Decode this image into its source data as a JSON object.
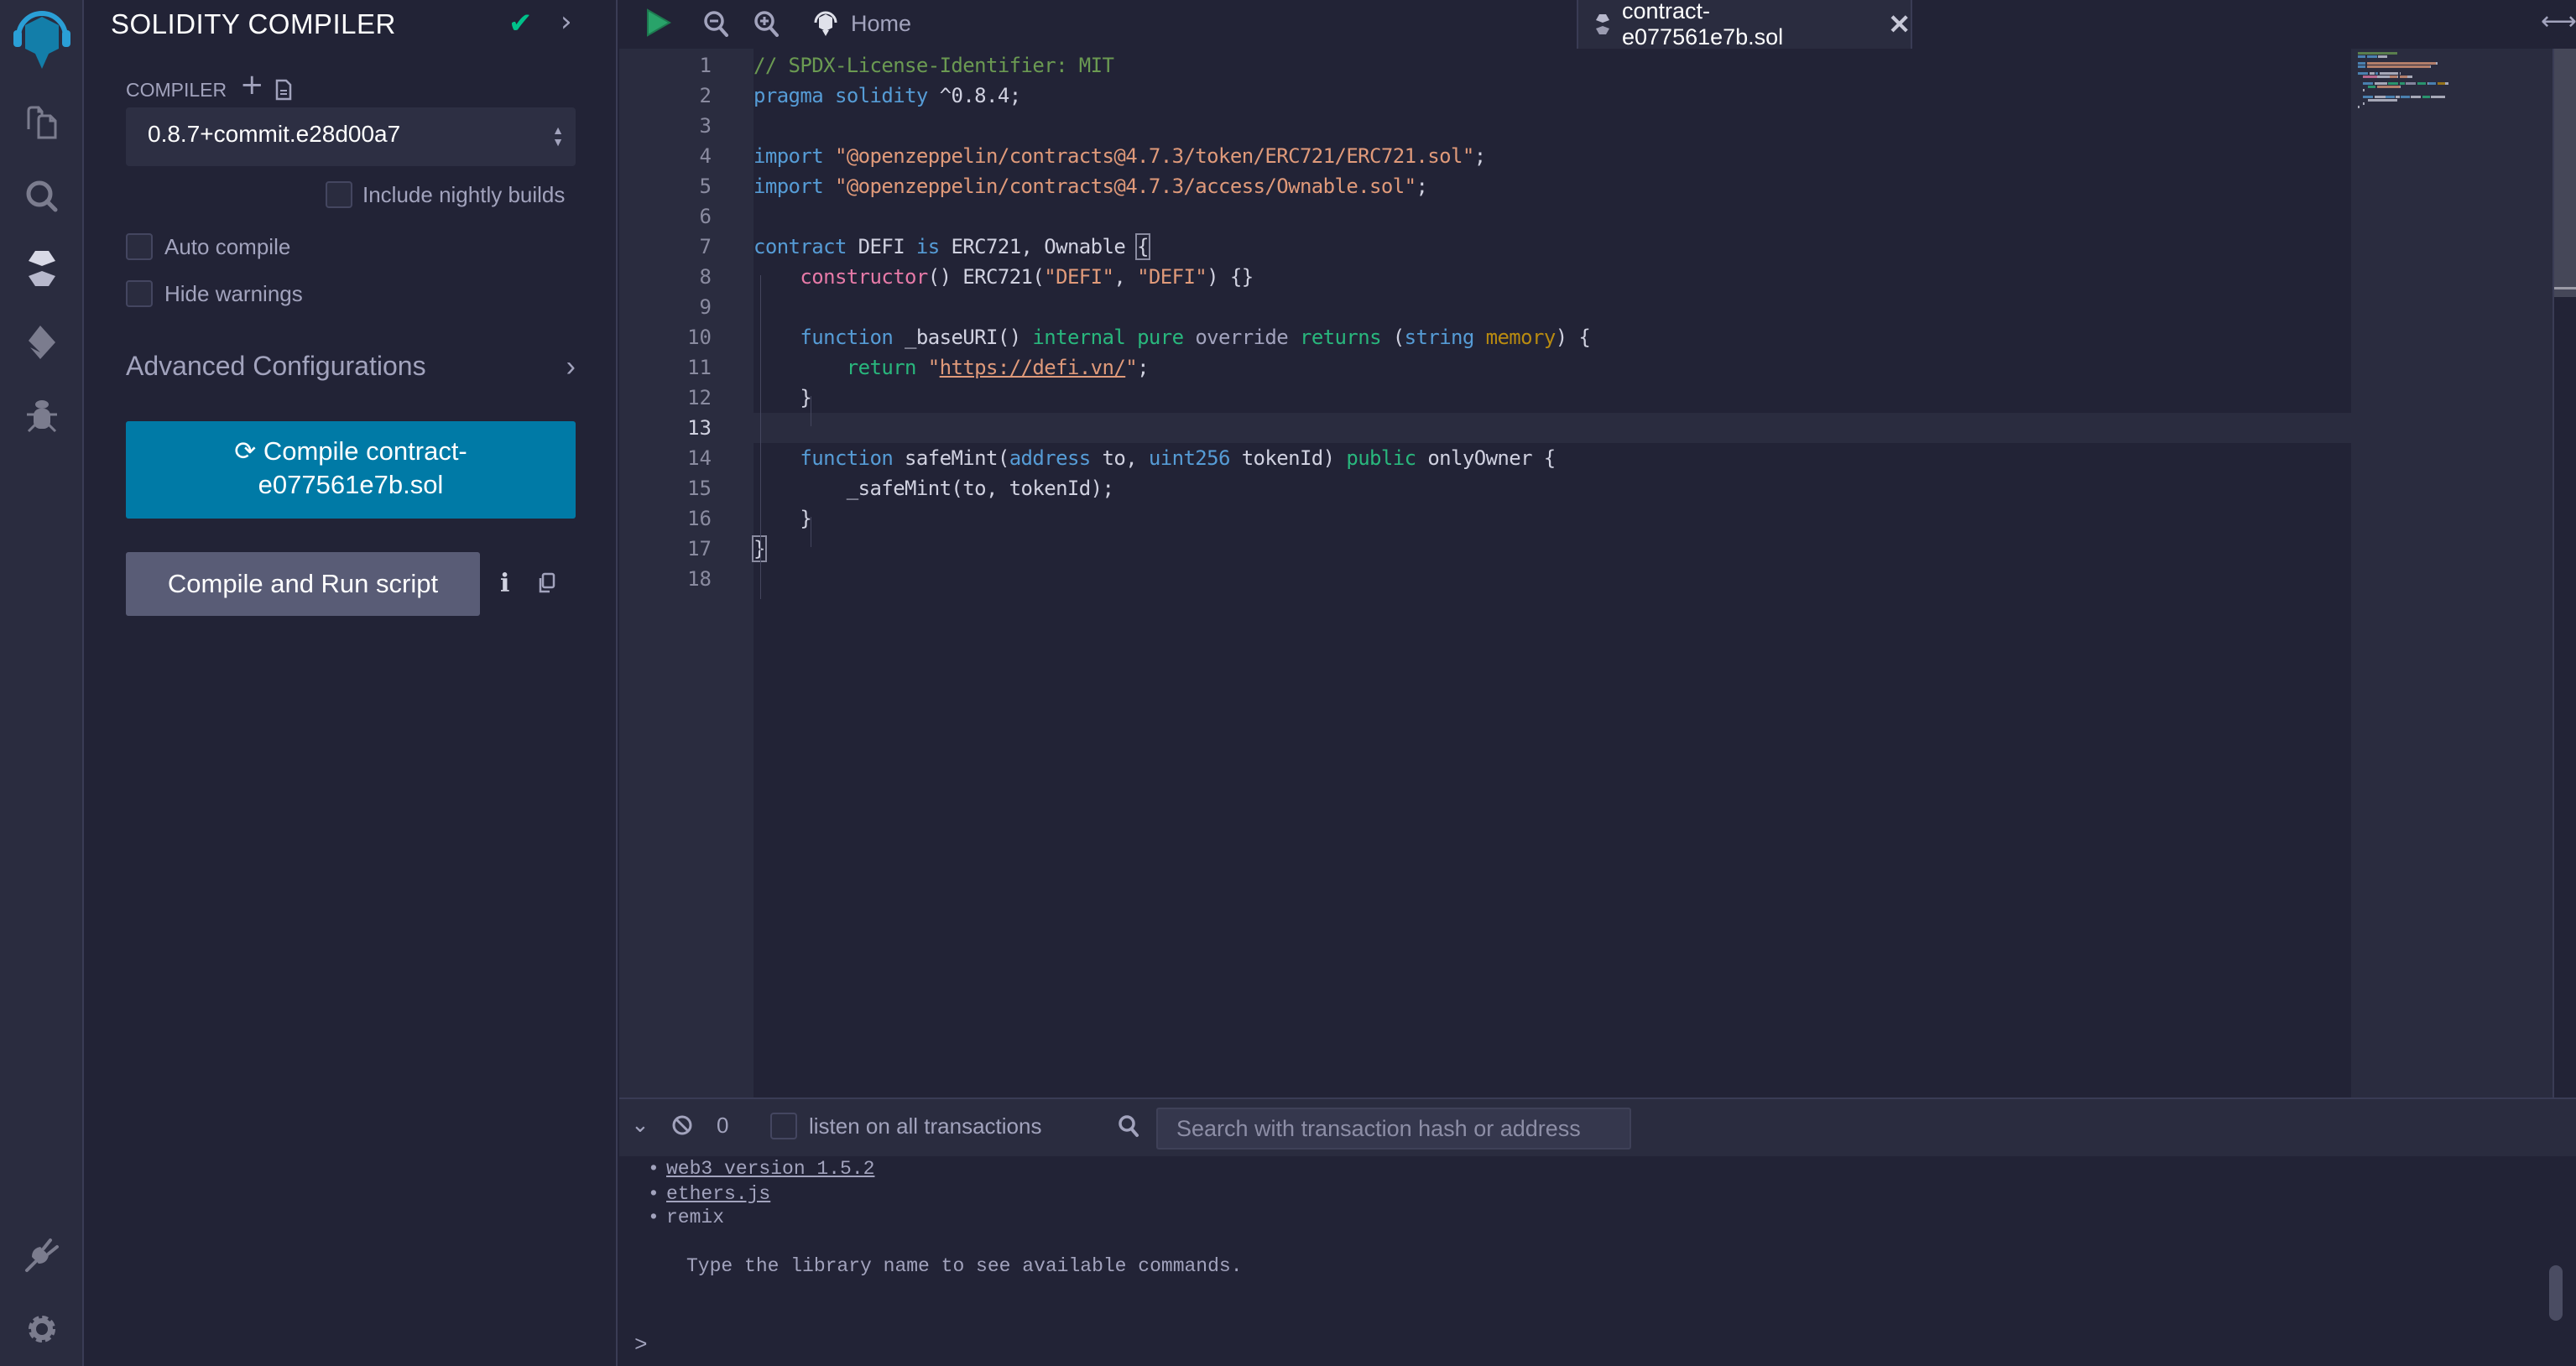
{
  "iconbar": {
    "items": [
      {
        "name": "home-logo",
        "label": "Remix home"
      },
      {
        "name": "file-explorer",
        "label": "File explorer"
      },
      {
        "name": "search",
        "label": "Search"
      },
      {
        "name": "solidity-compiler",
        "label": "Solidity compiler"
      },
      {
        "name": "deploy-run",
        "label": "Deploy & run transactions"
      },
      {
        "name": "debugger",
        "label": "Debugger"
      },
      {
        "name": "plugin-manager",
        "label": "Plugin manager"
      },
      {
        "name": "settings",
        "label": "Settings"
      }
    ]
  },
  "panel": {
    "title": "SOLIDITY COMPILER",
    "compiler_label": "COMPILER",
    "compiler_version": "0.8.7+commit.e28d00a7",
    "include_nightly_label": "Include nightly builds",
    "include_nightly_checked": false,
    "auto_compile_label": "Auto compile",
    "auto_compile_checked": false,
    "hide_warnings_label": "Hide warnings",
    "hide_warnings_checked": false,
    "advanced_label": "Advanced Configurations",
    "compile_button_line1": "Compile contract-",
    "compile_button_line2": "e077561e7b.sol",
    "run_button_label": "Compile and Run script"
  },
  "tabs": {
    "home_label": "Home",
    "active_file": "contract-e077561e7b.sol"
  },
  "editor": {
    "active_line": 13,
    "lines": [
      [
        [
          "t-com",
          "// SPDX-License-Identifier: MIT"
        ]
      ],
      [
        [
          "t-kw",
          "pragma"
        ],
        [
          "",
          " "
        ],
        [
          "t-kw",
          "solidity"
        ],
        [
          "",
          " ^0.8.4;"
        ]
      ],
      [],
      [
        [
          "t-kw",
          "import"
        ],
        [
          "",
          " "
        ],
        [
          "t-str",
          "\"@openzeppelin/contracts@4.7.3/token/ERC721/ERC721.sol\""
        ],
        [
          "",
          ";"
        ]
      ],
      [
        [
          "t-kw",
          "import"
        ],
        [
          "",
          " "
        ],
        [
          "t-str",
          "\"@openzeppelin/contracts@4.7.3/access/Ownable.sol\""
        ],
        [
          "",
          ";"
        ]
      ],
      [],
      [
        [
          "t-kw",
          "contract"
        ],
        [
          "",
          " DEFI "
        ],
        [
          "t-kw",
          "is"
        ],
        [
          "",
          " ERC721, Ownable "
        ],
        [
          "bracket-hl",
          "{"
        ]
      ],
      [
        [
          "",
          "    "
        ],
        [
          "t-fn",
          "constructor"
        ],
        [
          "",
          "() ERC721("
        ],
        [
          "t-str",
          "\"DEFI\""
        ],
        [
          "",
          ", "
        ],
        [
          "t-str",
          "\"DEFI\""
        ],
        [
          "",
          ") {}"
        ]
      ],
      [],
      [
        [
          "",
          "    "
        ],
        [
          "t-kw",
          "function"
        ],
        [
          "",
          " _baseURI() "
        ],
        [
          "t-green",
          "internal"
        ],
        [
          "",
          " "
        ],
        [
          "t-green",
          "pure"
        ],
        [
          "",
          " "
        ],
        [
          "t-gray",
          "override"
        ],
        [
          "",
          " "
        ],
        [
          "t-green",
          "returns"
        ],
        [
          "",
          " ("
        ],
        [
          "t-kw",
          "string"
        ],
        [
          "",
          " "
        ],
        [
          "t-mem",
          "memory"
        ],
        [
          "",
          ") {"
        ]
      ],
      [
        [
          "",
          "        "
        ],
        [
          "t-green",
          "return"
        ],
        [
          "",
          " "
        ],
        [
          "t-str",
          "\""
        ],
        [
          "t-str t-url",
          "https://defi.vn/"
        ],
        [
          "t-str",
          "\""
        ],
        [
          "",
          ";"
        ]
      ],
      [
        [
          "",
          "    }"
        ]
      ],
      [],
      [
        [
          "",
          "    "
        ],
        [
          "t-kw",
          "function"
        ],
        [
          "",
          " safeMint("
        ],
        [
          "t-kw",
          "address"
        ],
        [
          "",
          " to, "
        ],
        [
          "t-kw",
          "uint256"
        ],
        [
          "",
          " tokenId) "
        ],
        [
          "t-green",
          "public"
        ],
        [
          "",
          " onlyOwner {"
        ]
      ],
      [
        [
          "",
          "        _safeMint(to, tokenId);"
        ]
      ],
      [
        [
          "",
          "    }"
        ]
      ],
      [
        [
          "bracket-hl",
          "}"
        ]
      ],
      []
    ]
  },
  "terminal": {
    "pending_count": "0",
    "listen_label": "listen on all transactions",
    "listen_checked": false,
    "search_placeholder": "Search with transaction hash or address",
    "items": [
      "web3 version 1.5.2",
      "ethers.js",
      "remix"
    ],
    "hint": "Type the library name to see available commands.",
    "prompt": ">"
  }
}
